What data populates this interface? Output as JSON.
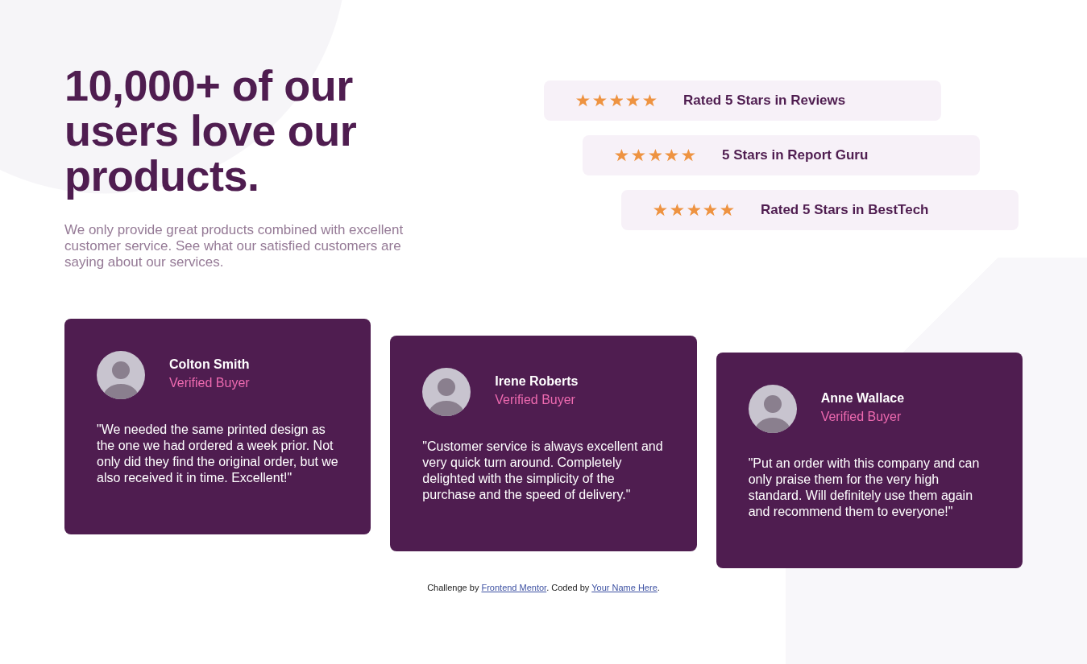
{
  "hero": {
    "heading": "10,000+ of our users love our products.",
    "text": "We only provide great products combined with excellent customer service. See what our satisfied customers are saying about our services."
  },
  "ratings": [
    {
      "stars": 5,
      "label": "Rated 5 Stars in Reviews"
    },
    {
      "stars": 5,
      "label": "5 Stars in Report Guru"
    },
    {
      "stars": 5,
      "label": "Rated 5 Stars in BestTech"
    }
  ],
  "testimonials": [
    {
      "name": "Colton Smith",
      "role": "Verified Buyer",
      "quote": "\"We needed the same printed design as the one we had ordered a week prior. Not only did they find the original order, but we also received it in time. Excellent!\""
    },
    {
      "name": "Irene Roberts",
      "role": "Verified Buyer",
      "quote": "\"Customer service is always excellent and very quick turn around. Completely delighted with the simplicity of the purchase and the speed of delivery.\""
    },
    {
      "name": "Anne Wallace",
      "role": "Verified Buyer",
      "quote": "\"Put an order with this company and can only praise them for the very high standard. Will definitely use them again and recommend them to everyone!\""
    }
  ],
  "footer": {
    "parts": [
      {
        "kind": "text",
        "text": "Challenge by "
      },
      {
        "kind": "link",
        "text": "Frontend Mentor"
      },
      {
        "kind": "text",
        "text": ". Coded by "
      },
      {
        "kind": "link",
        "text": "Your Name Here"
      },
      {
        "kind": "text",
        "text": "."
      }
    ]
  }
}
